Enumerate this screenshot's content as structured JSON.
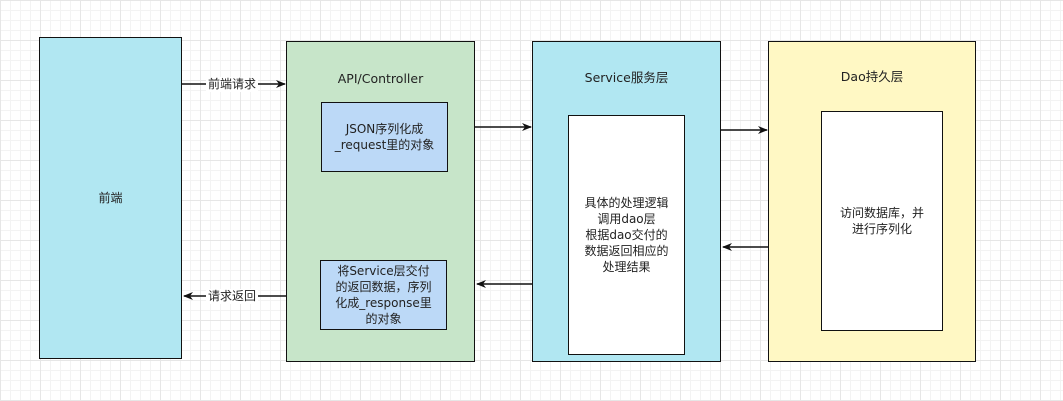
{
  "nodes": {
    "frontend": {
      "label": "前端"
    },
    "controller": {
      "title": "API/Controller",
      "request_box": "JSON序列化成\n_request里的对象",
      "response_box": "将Service层交付\n的返回数据，序列\n化成_response里\n的对象"
    },
    "service": {
      "title": "Service服务层",
      "inner": "具体的处理逻辑\n调用dao层\n根据dao交付的\n数据返回相应的\n处理结果"
    },
    "dao": {
      "title": "Dao持久层",
      "inner": "访问数据库，并\n进行序列化"
    }
  },
  "edges": {
    "request_label": "前端请求",
    "return_label": "请求返回"
  },
  "colors": {
    "cyan_fill": "#b1e7f2",
    "green_fill": "#c7e5c9",
    "yellow_fill": "#fff8c4",
    "blue_fill": "#bcd9f7",
    "stroke": "#111111"
  }
}
